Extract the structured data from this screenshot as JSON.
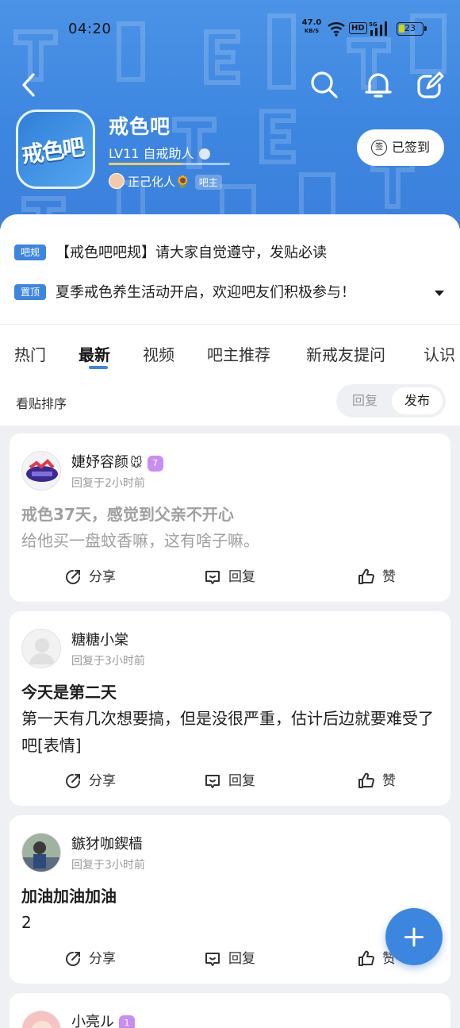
{
  "status_bar": {
    "time": "04:20",
    "net_speed": "47.0",
    "net_unit": "KB/S",
    "hd": "HD",
    "signal": "5G",
    "battery": "23"
  },
  "header": {
    "forum_name": "戒色吧",
    "avatar_text": "戒色吧",
    "level_text": "LV11 自戒助人",
    "level_progress": 0.6,
    "owner_name": "正己化人🌻",
    "owner_tag": "吧主",
    "signin_label": "已签到",
    "signin_icon_text": "签"
  },
  "notices": [
    {
      "tag": "吧规",
      "text": "【戒色吧吧规】请大家自觉遵守，发贴必读"
    },
    {
      "tag": "置顶",
      "text": "夏季戒色养生活动开启，欢迎吧友们积极参与！"
    }
  ],
  "tabs": [
    "热门",
    "最新",
    "视频",
    "吧主推荐",
    "新戒友提问",
    "认识"
  ],
  "active_tab": "最新",
  "sort": {
    "label": "看贴排序",
    "options": [
      "回复",
      "发布"
    ],
    "selected": "发布"
  },
  "actions": {
    "share": "分享",
    "reply": "回复",
    "like": "赞"
  },
  "posts": [
    {
      "user": "婕妤容颜",
      "emoji": "🐭",
      "badge": "7",
      "time": "回复于2小时前",
      "title": "戒色37天，感觉到父亲不开心",
      "body": "给他买一盘蚊香嘛，这有啥子嘛。"
    },
    {
      "user": "糖糖小棠",
      "time": "回复于3小时前",
      "title": "今天是第二天",
      "body": "第一天有几次想要搞，但是没很严重，估计后边就要难受了吧[表情]"
    },
    {
      "user": "鏃犲咖鍥樯",
      "time": "回复于3小时前",
      "title": "加油加油加油",
      "body": "2"
    },
    {
      "user": "小亮ル",
      "badge": "1"
    }
  ],
  "colors": {
    "brand": "#3d86e0",
    "level_bar": "#f3cf57",
    "badge": "#c78ef0"
  },
  "icons": [
    "back-icon",
    "search-icon",
    "bell-icon",
    "edit-icon",
    "share-icon",
    "reply-icon",
    "like-icon",
    "plus-icon",
    "expand-icon"
  ]
}
